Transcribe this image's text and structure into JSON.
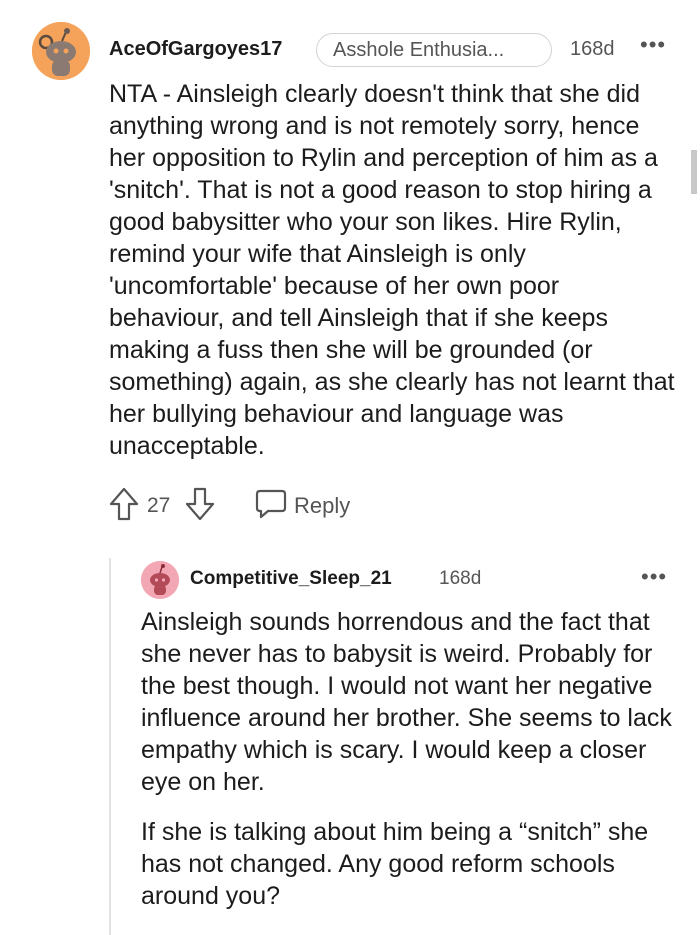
{
  "comment": {
    "username": "AceOfGargoyes17",
    "flair": "Asshole Enthusia...",
    "time": "168d",
    "more": "•••",
    "body": "NTA - Ainsleigh clearly doesn't think that she did anything wrong and is not remotely sorry, hence her opposition to Rylin and perception of him as a 'snitch'. That is not a good reason to stop hiring a good babysitter who your son likes. Hire Rylin, remind your wife that Ainsleigh is only 'uncomfortable' because of her own poor behaviour, and tell Ainsleigh that if she keeps making a fuss then she will be grounded (or something) again, as she clearly has not learnt that her bullying behaviour and language was unacceptable.",
    "votes": "27",
    "reply_label": "Reply",
    "avatar_color": "#f5a35a"
  },
  "reply": {
    "username": "Competitive_Sleep_21",
    "time": "168d",
    "more": "•••",
    "paragraphs": [
      "Ainsleigh sounds horrendous and the fact that she never has to babysit is weird. Probably for the best though. I would not want her negative influence around her brother. She seems to lack empathy which is scary. I would keep a closer eye on her.",
      "If she is talking about him being a “snitch” she has not changed. Any good reform schools around you?"
    ],
    "avatar_color": "#f3a7b4"
  }
}
